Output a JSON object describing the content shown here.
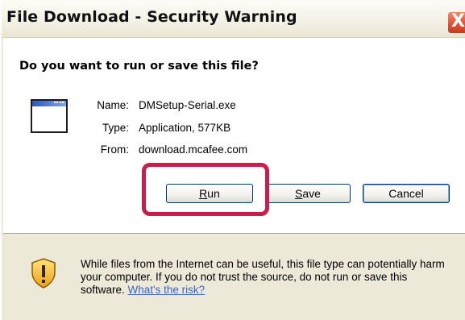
{
  "window": {
    "title": "File Download - Security Warning",
    "close_glyph": "X"
  },
  "prompt": {
    "question": "Do you want to run or save this file?"
  },
  "file_info": {
    "icon": "application-window-icon",
    "name_label": "Name:",
    "name_value": "DMSetup-Serial.exe",
    "type_label": "Type:",
    "type_value": "Application, 577KB",
    "from_label": "From:",
    "from_value": "download.mcafee.com"
  },
  "buttons": {
    "run_accel": "R",
    "run_rest": "un",
    "save_accel": "S",
    "save_rest": "ave",
    "cancel": "Cancel"
  },
  "warning": {
    "icon": "security-shield-icon",
    "text": "While files from the Internet can be useful, this file type can potentially harm your computer. If you do not trust the source, do not run or save this software.",
    "link": "What's the risk?"
  },
  "colors": {
    "highlight": "#c81e4b",
    "link": "#3b64c8",
    "close_button": "#e2583a"
  }
}
